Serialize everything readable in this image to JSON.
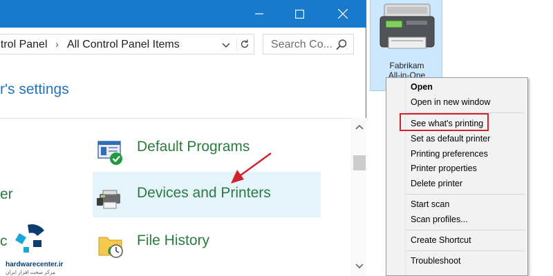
{
  "titlebar": {
    "minimize_icon": "minimize-icon",
    "maximize_icon": "maximize-icon",
    "close_icon": "close-icon",
    "color": "#1979ca"
  },
  "address": {
    "crumbs": [
      "ntrol Panel",
      "All Control Panel Items"
    ]
  },
  "search": {
    "placeholder": "Search Co..."
  },
  "heading": "r's settings",
  "items": [
    {
      "label": "Default Programs",
      "icon": "default-programs-icon"
    },
    {
      "label": "Devices and Printers",
      "icon": "printer-icon"
    },
    {
      "label": "File History",
      "icon": "file-history-icon"
    }
  ],
  "partial_items": [
    "er",
    "c"
  ],
  "desktop_printer": {
    "name_line1": "Fabrikam",
    "name_line2": "All-in-One"
  },
  "context_menu": {
    "items": [
      "Open",
      "Open in new window",
      "See what's printing",
      "Set as default printer",
      "Printing preferences",
      "Printer properties",
      "Delete printer",
      "Start scan",
      "Scan profiles...",
      "Create Shortcut",
      "Troubleshoot"
    ],
    "highlight_color": "#d2232a"
  },
  "watermark": {
    "brand": "hardwarecenter.ir",
    "tagline": "مرکز سخت افزار ایران"
  }
}
